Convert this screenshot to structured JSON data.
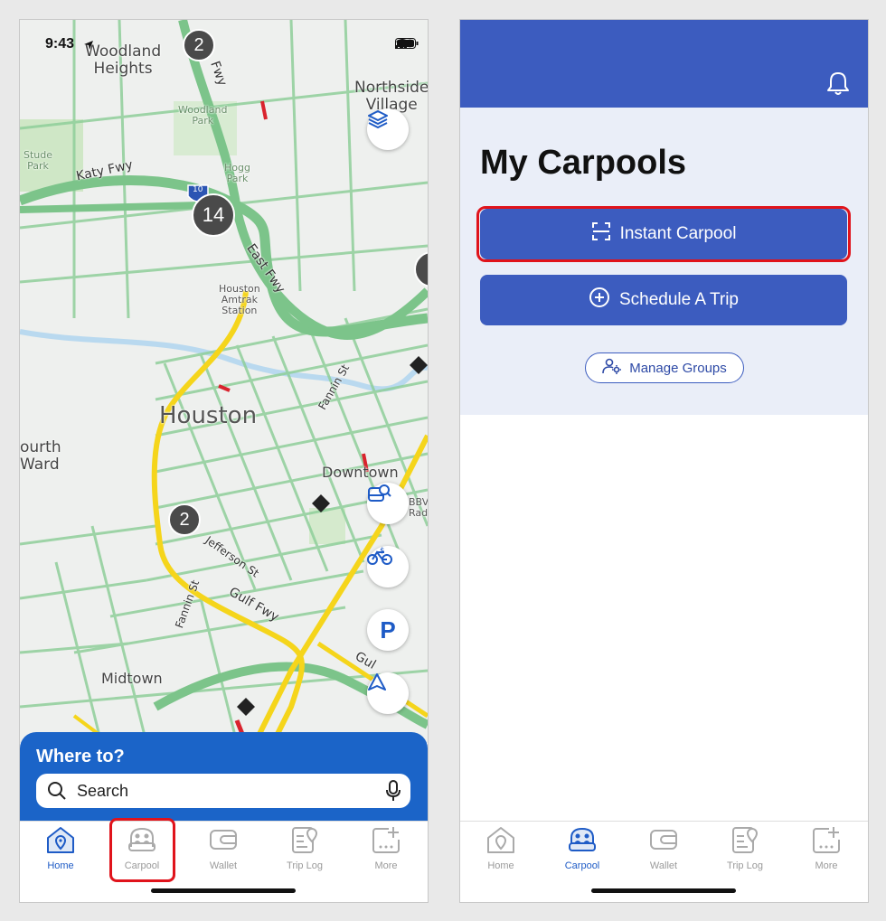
{
  "left": {
    "status": {
      "time": "9:43"
    },
    "map_labels": {
      "woodland_heights": "Woodland\nHeights",
      "woodland_park": "Woodland\nPark",
      "northside_village": "Northside\nVillage",
      "stude_park": "Stude\nPark",
      "katy_fwy": "Katy Fwy",
      "hogg_park": "Hogg\nPark",
      "i10": "10",
      "east_fwy": "East Fwy",
      "fwy_top": "Fwy",
      "amtrak": "Houston\nAmtrak\nStation",
      "houston": "Houston",
      "fannin_st_1": "Fannin St",
      "fourth_ward": "ourth\nWard",
      "downtown": "Downtown",
      "bbva": "BBV\nRadi",
      "jefferson_st": "Jefferson St",
      "fannin_st_2": "Fannin St",
      "gulf_fwy": "Gulf Fwy",
      "gul": "Gul",
      "midtown": "Midtown"
    },
    "clusters": [
      "2",
      "14",
      "2"
    ],
    "fab_parking": "P",
    "where_to": "Where to?",
    "search_placeholder": "Search"
  },
  "tabs": [
    {
      "label": "Home",
      "icon": "home-icon"
    },
    {
      "label": "Carpool",
      "icon": "carpool-icon"
    },
    {
      "label": "Wallet",
      "icon": "wallet-icon"
    },
    {
      "label": "Trip Log",
      "icon": "trip-log-icon"
    },
    {
      "label": "More",
      "icon": "more-icon"
    }
  ],
  "right": {
    "title": "My Carpools",
    "instant_carpool": "Instant Carpool",
    "schedule_trip": "Schedule A Trip",
    "manage_groups": "Manage Groups"
  },
  "colors": {
    "brand_blue": "#3c5cbf",
    "where_panel": "#1b64c8",
    "highlight": "#e0131b",
    "active_tab": "#1e5bc6"
  }
}
